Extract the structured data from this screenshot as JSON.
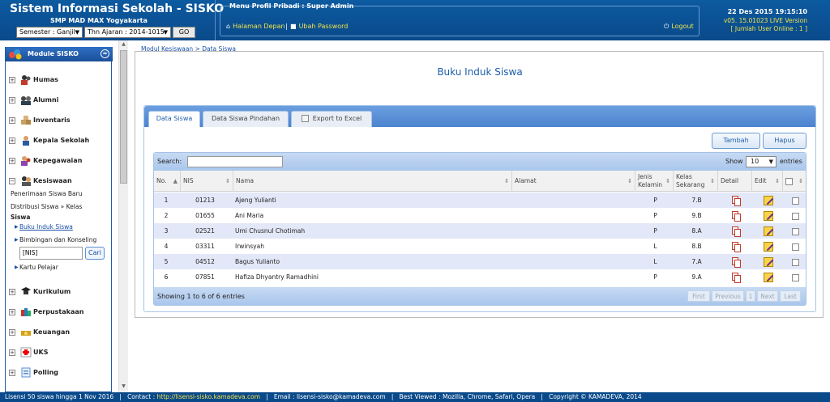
{
  "header": {
    "app_title": "Sistem Informasi Sekolah - SISKO",
    "school": "SMP MAD MAX Yogyakarta",
    "semester": "Semester : Ganjil",
    "tahun_ajaran": "Thn Ajaran : 2014-1015",
    "go_label": "GO",
    "menu_legend": "Menu Profil Pribadi : Super Admin",
    "home_link": "Halaman Depan",
    "separator": "|",
    "password_link": "Ubah Password",
    "logout_link": "Logout",
    "datetime": "22 Des 2015 19:15:10",
    "version": "v05. 15.01023 LIVE Version",
    "online": "[ Jumlah User Online : 1 ]"
  },
  "sidebar": {
    "title": "Module SISKO",
    "items": [
      {
        "label": "Humas",
        "icon": "people-icon"
      },
      {
        "label": "Alumni",
        "icon": "graduates-icon"
      },
      {
        "label": "Inventaris",
        "icon": "boxes-icon"
      },
      {
        "label": "Kepala Sekolah",
        "icon": "person-icon"
      },
      {
        "label": "Kepegawaian",
        "icon": "staff-icon"
      },
      {
        "label": "Kesiswaan",
        "icon": "students-icon"
      },
      {
        "label": "Kurikulum",
        "icon": "mortarboard-icon"
      },
      {
        "label": "Perpustakaan",
        "icon": "books-icon"
      },
      {
        "label": "Keuangan",
        "icon": "money-icon"
      },
      {
        "label": "UKS",
        "icon": "medical-cross-icon"
      },
      {
        "label": "Polling",
        "icon": "poll-icon"
      }
    ],
    "kesiswaan_sub": {
      "penerimaan": "Penerimaan Siswa Baru",
      "distribusi": "Distribusi Siswa » Kelas",
      "siswa": "Siswa",
      "buku_induk": "Buku Induk Siswa",
      "bimbingan": "Bimbingan dan Konseling",
      "nis_value": "[NIS]",
      "cari": "Cari",
      "kartu": "Kartu Pelajar"
    }
  },
  "main": {
    "breadcrumb": "Modul Kesiswaan > Data Siswa",
    "title": "Buku Induk Siswa",
    "tabs": [
      "Data Siswa",
      "Data Siswa Pindahan",
      "Export to Excel"
    ],
    "tambah": "Tambah",
    "hapus": "Hapus",
    "search_label": "Search:",
    "show_label": "Show",
    "show_value": "10",
    "entries_label": "entries",
    "columns": {
      "no": "No.",
      "nis": "NIS",
      "nama": "Nama",
      "alamat": "Alamat",
      "jk1": "Jenis",
      "jk2": "Kelamin",
      "kls1": "Kelas",
      "kls2": "Sekarang",
      "detail": "Detail",
      "edit": "Edit"
    },
    "rows": [
      {
        "no": "1",
        "nis": "01213",
        "nama": "Ajeng Yulianti",
        "jk": "P",
        "kelas": "7.B"
      },
      {
        "no": "2",
        "nis": "01655",
        "nama": "Ani Maria",
        "jk": "P",
        "kelas": "9.B"
      },
      {
        "no": "3",
        "nis": "02521",
        "nama": "Umi Chusnul Chotimah",
        "jk": "P",
        "kelas": "8.A"
      },
      {
        "no": "4",
        "nis": "03311",
        "nama": "Irwinsyah",
        "jk": "L",
        "kelas": "8.B"
      },
      {
        "no": "5",
        "nis": "04512",
        "nama": "Bagus Yulianto",
        "jk": "L",
        "kelas": "7.A"
      },
      {
        "no": "6",
        "nis": "07851",
        "nama": "Hafiza Dhyantry Ramadhini",
        "jk": "P",
        "kelas": "9.A"
      }
    ],
    "footer_info": "Showing 1 to 6 of 6 entries",
    "pager": {
      "first": "First",
      "previous": "Previous",
      "page": "1",
      "next": "Next",
      "last": "Last"
    }
  },
  "statusbar": {
    "license": "Lisensi 50 siswa hingga 1 Nov 2016",
    "contact_label": "Contact :",
    "contact_url": "http://lisensi-sisko.kamadeva.com",
    "email": "Email : lisensi-sisko@kamadeva.com",
    "best_viewed": "Best Viewed : Mozilla, Chrome, Safari, Opera",
    "copyright": "Copyright © KAMADEVA, 2014"
  },
  "colors": {
    "header_bg": "#0a4a8a",
    "accent": "#1d5ea8",
    "link_yellow": "#f2e24a"
  }
}
